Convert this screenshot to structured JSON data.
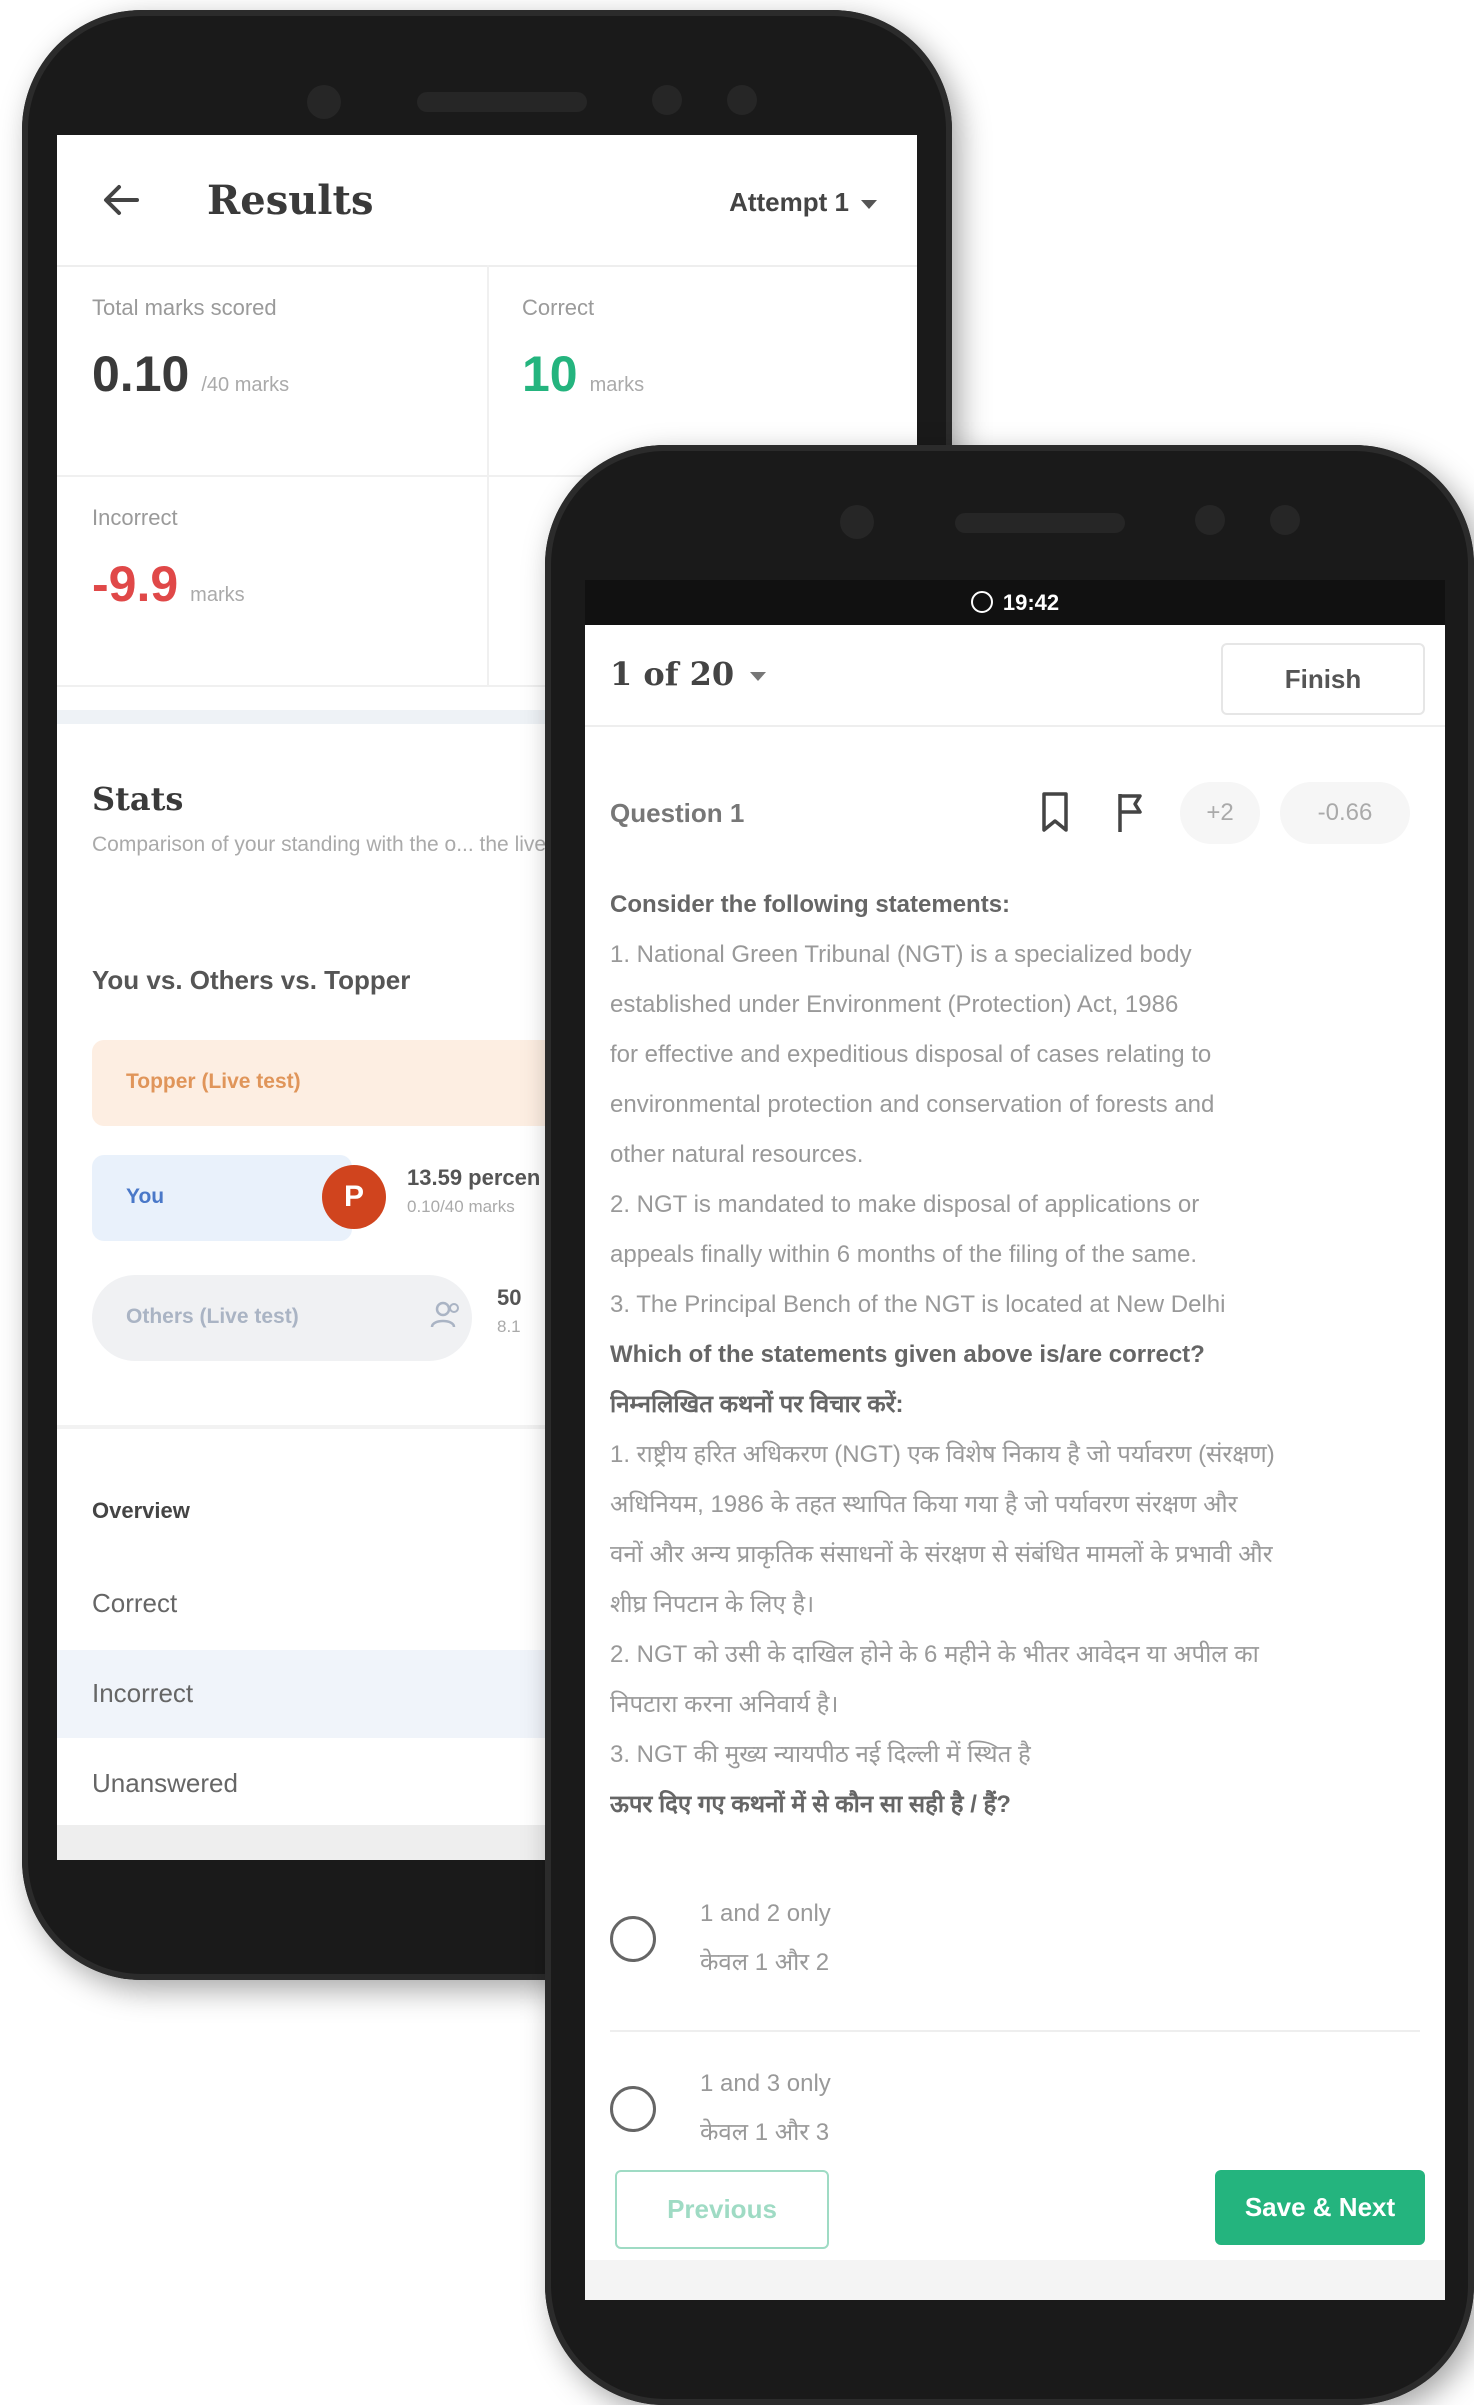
{
  "results_screen": {
    "title": "Results",
    "attempt_selector": "Attempt 1",
    "stats": [
      {
        "label": "Total marks scored",
        "value": "0.10",
        "unit": "/40 marks",
        "color": "#3a3a3a"
      },
      {
        "label": "Correct",
        "value": "10",
        "unit": "marks",
        "color": "#24b47e"
      },
      {
        "label": "Incorrect",
        "value": "-9.9",
        "unit": "marks",
        "color": "#e04848"
      }
    ],
    "stats_section": {
      "title": "Stats",
      "subtitle": "Comparison of your standing with the o... the live test"
    },
    "comparison": {
      "title": "You vs. Others vs. Topper",
      "topper_label": "Topper (Live test)",
      "you_label": "You",
      "you_avatar": "P",
      "you_percentile": "13.59 percen",
      "you_marks": "0.10/40 marks",
      "others_label": "Others (Live test)",
      "others_percentile": "50",
      "others_marks": "8.1"
    },
    "nav": {
      "overview": "Overview",
      "correct": "Correct",
      "incorrect": "Incorrect",
      "unanswered": "Unanswered"
    }
  },
  "question_screen": {
    "status_time": "19:42",
    "question_counter": "1 of 20",
    "finish_label": "Finish",
    "question_title": "Question 1",
    "positive_marks": "+2",
    "negative_marks": "-0.66",
    "question_lines": [
      {
        "text": "Consider the following statements:",
        "bold": true
      },
      {
        "text": "1. National Green Tribunal (NGT) is a specialized body",
        "bold": false
      },
      {
        "text": "established under Environment (Protection) Act, 1986",
        "bold": false
      },
      {
        "text": "for effective and expeditious disposal of cases relating to",
        "bold": false
      },
      {
        "text": "environmental protection and conservation of forests and",
        "bold": false
      },
      {
        "text": "other natural resources.",
        "bold": false
      },
      {
        "text": "2. NGT is mandated to make disposal of applications or",
        "bold": false
      },
      {
        "text": "appeals finally within 6 months of the filing of the same.",
        "bold": false
      },
      {
        "text": "3. The Principal Bench of the NGT is located at New Delhi",
        "bold": false
      },
      {
        "text": "Which of the statements given above is/are correct?",
        "bold": true
      },
      {
        "text": "निम्नलिखित कथनों पर विचार करें:",
        "bold": true
      },
      {
        "text": "1. राष्ट्रीय हरित अधिकरण (NGT) एक विशेष निकाय है जो पर्यावरण (संरक्षण)",
        "bold": false
      },
      {
        "text": "अधिनियम, 1986 के तहत स्थापित किया गया है जो पर्यावरण संरक्षण और",
        "bold": false
      },
      {
        "text": "वनों और अन्य प्राकृतिक संसाधनों के संरक्षण से संबंधित मामलों के प्रभावी और",
        "bold": false
      },
      {
        "text": "शीघ्र निपटान के लिए है।",
        "bold": false
      },
      {
        "text": "2. NGT को उसी के दाखिल होने के 6 महीने के भीतर आवेदन या अपील का",
        "bold": false
      },
      {
        "text": "निपटारा करना अनिवार्य है।",
        "bold": false
      },
      {
        "text": "3. NGT की मुख्य न्यायपीठ नई दिल्ली में स्थित है",
        "bold": false
      },
      {
        "text": "ऊपर दिए गए कथनों में से कौन सा सही है / हैं?",
        "bold": true
      }
    ],
    "options": [
      {
        "en": "1 and 2 only",
        "hi": "केवल 1 और 2"
      },
      {
        "en": "1 and 3 only",
        "hi": "केवल 1 और 3"
      }
    ],
    "previous_label": "Previous",
    "save_next_label": "Save & Next"
  },
  "colors": {
    "accent_green": "#24b47e",
    "incorrect_red": "#e04848",
    "avatar_orange": "#d0441e"
  }
}
